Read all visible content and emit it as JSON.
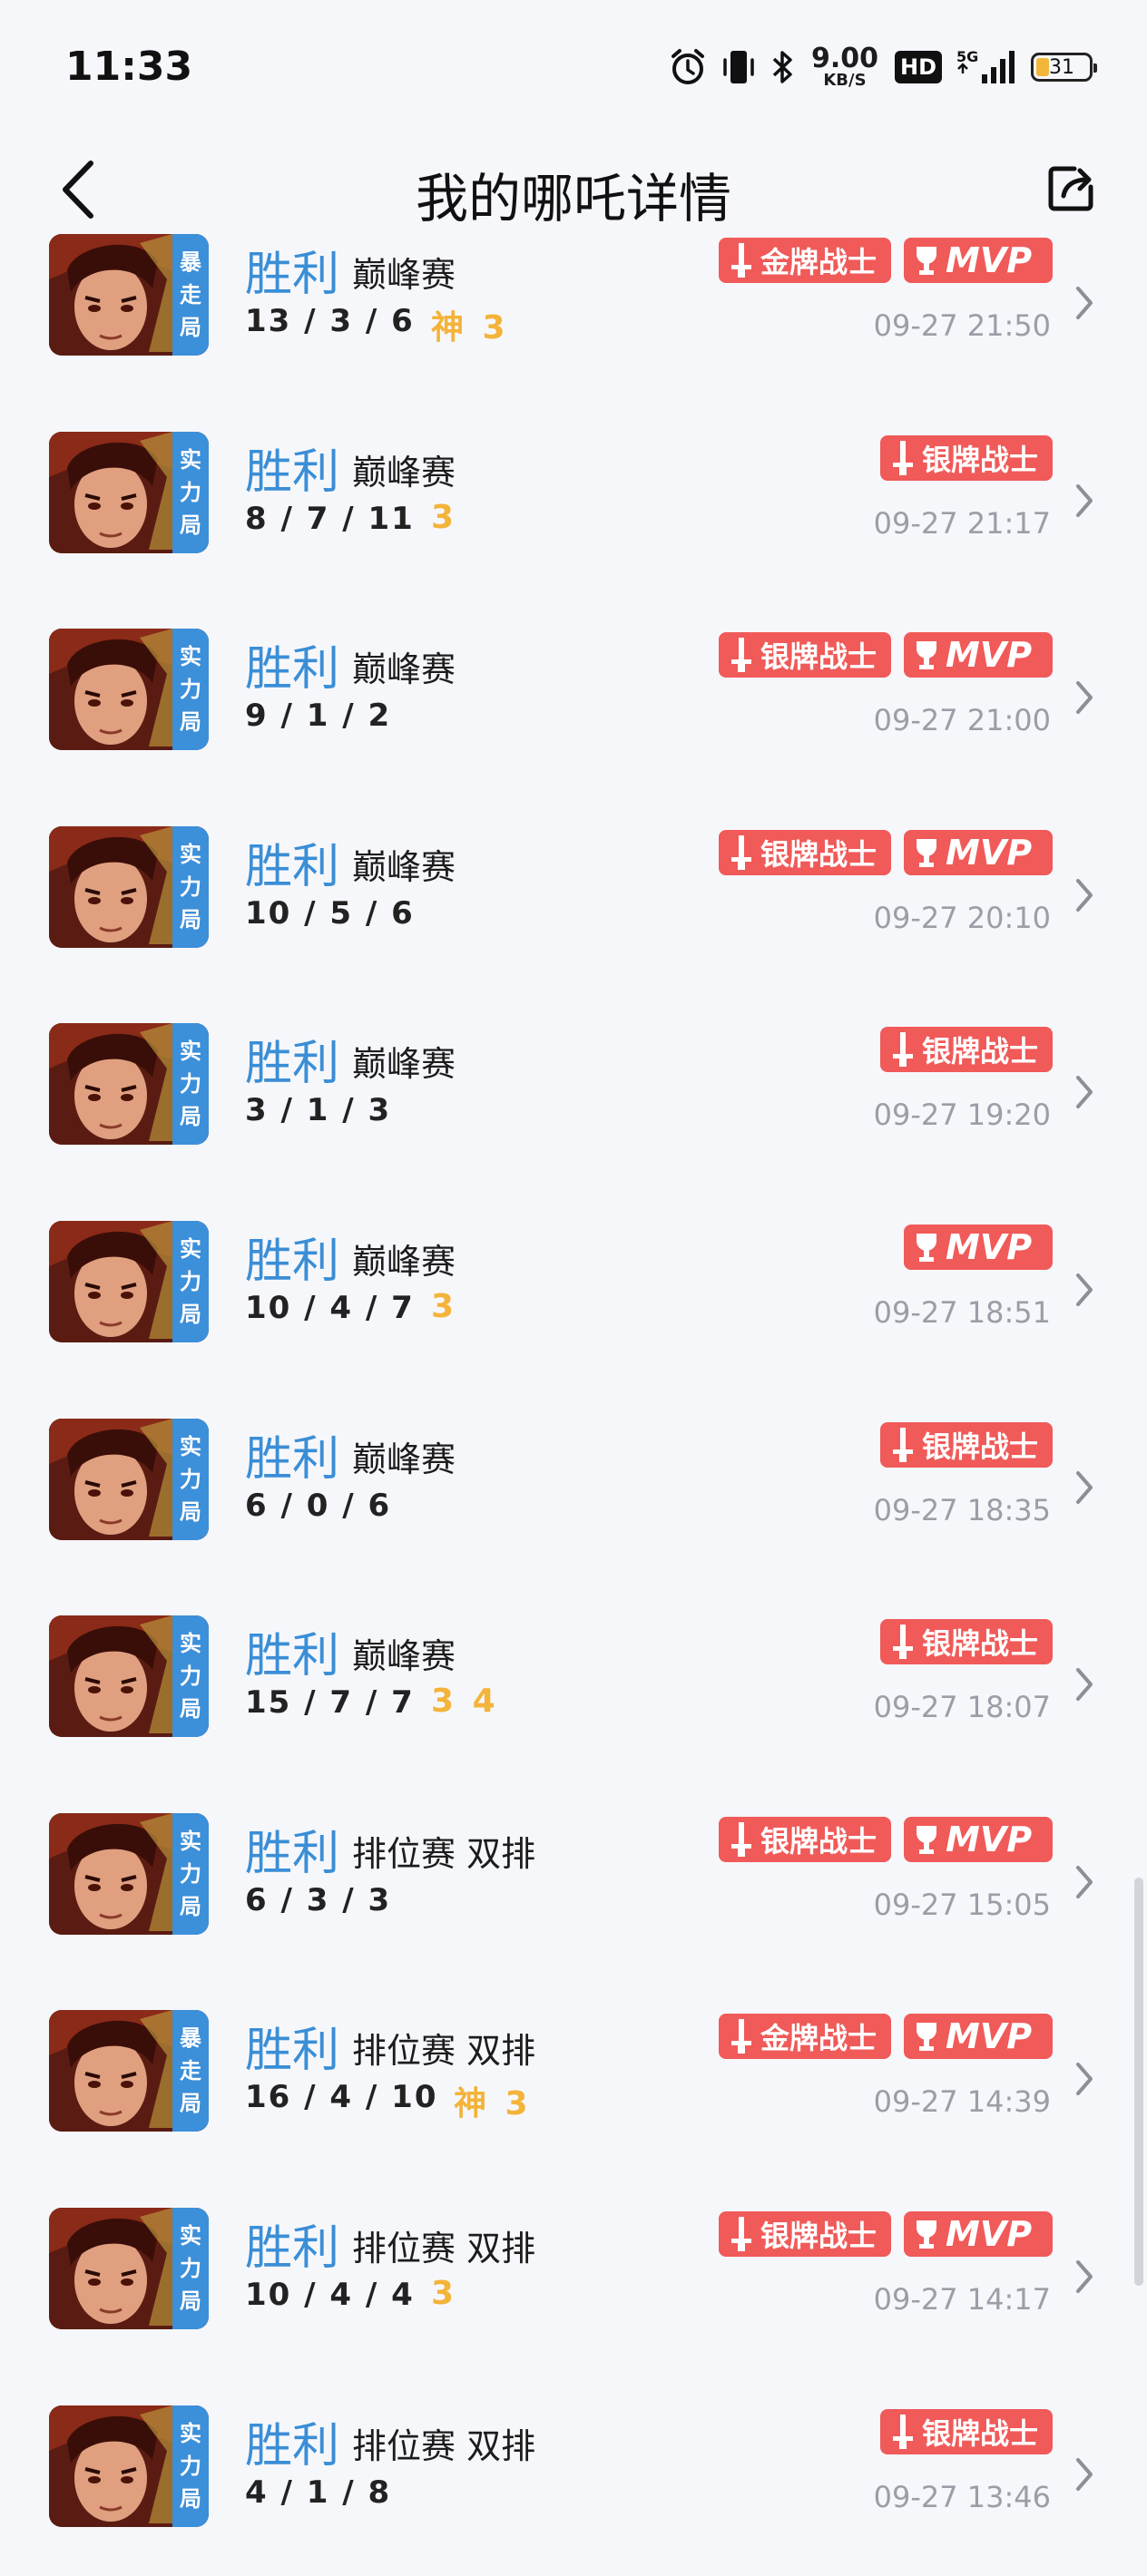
{
  "status_bar": {
    "time": "11:33",
    "speed_value": "9.00",
    "speed_unit": "KB/S",
    "hd": "HD",
    "network": "5G",
    "battery": "31"
  },
  "header": {
    "title": "我的哪吒详情"
  },
  "colors": {
    "win": "#3a8ed6",
    "badge_red": "#f05a59",
    "mode_tag_blue": "#3c8fd9",
    "accent_gold": "#f4b339"
  },
  "matches": [
    {
      "tag": [
        "暴",
        "走",
        "局"
      ],
      "result": "胜利",
      "mode": "巅峰赛",
      "kda": "13 / 3 / 6",
      "extra": "神 3",
      "badges": [
        {
          "type": "warrior",
          "label": "金牌战士"
        },
        {
          "type": "mvp",
          "label": "MVP"
        }
      ],
      "time": "09-27 21:50"
    },
    {
      "tag": [
        "实",
        "力",
        "局"
      ],
      "result": "胜利",
      "mode": "巅峰赛",
      "kda": "8 / 7 / 11",
      "extra": "3",
      "badges": [
        {
          "type": "warrior",
          "label": "银牌战士"
        }
      ],
      "time": "09-27 21:17"
    },
    {
      "tag": [
        "实",
        "力",
        "局"
      ],
      "result": "胜利",
      "mode": "巅峰赛",
      "kda": "9 / 1 / 2",
      "extra": "",
      "badges": [
        {
          "type": "warrior",
          "label": "银牌战士"
        },
        {
          "type": "mvp",
          "label": "MVP"
        }
      ],
      "time": "09-27 21:00"
    },
    {
      "tag": [
        "实",
        "力",
        "局"
      ],
      "result": "胜利",
      "mode": "巅峰赛",
      "kda": "10 / 5 / 6",
      "extra": "",
      "badges": [
        {
          "type": "warrior",
          "label": "银牌战士"
        },
        {
          "type": "mvp",
          "label": "MVP"
        }
      ],
      "time": "09-27 20:10"
    },
    {
      "tag": [
        "实",
        "力",
        "局"
      ],
      "result": "胜利",
      "mode": "巅峰赛",
      "kda": "3 / 1 / 3",
      "extra": "",
      "badges": [
        {
          "type": "warrior",
          "label": "银牌战士"
        }
      ],
      "time": "09-27 19:20"
    },
    {
      "tag": [
        "实",
        "力",
        "局"
      ],
      "result": "胜利",
      "mode": "巅峰赛",
      "kda": "10 / 4 / 7",
      "extra": "3",
      "badges": [
        {
          "type": "mvp",
          "label": "MVP"
        }
      ],
      "time": "09-27 18:51"
    },
    {
      "tag": [
        "实",
        "力",
        "局"
      ],
      "result": "胜利",
      "mode": "巅峰赛",
      "kda": "6 / 0 / 6",
      "extra": "",
      "badges": [
        {
          "type": "warrior",
          "label": "银牌战士"
        }
      ],
      "time": "09-27 18:35"
    },
    {
      "tag": [
        "实",
        "力",
        "局"
      ],
      "result": "胜利",
      "mode": "巅峰赛",
      "kda": "15 / 7 / 7",
      "extra": "3 4",
      "badges": [
        {
          "type": "warrior",
          "label": "银牌战士"
        }
      ],
      "time": "09-27 18:07"
    },
    {
      "tag": [
        "实",
        "力",
        "局"
      ],
      "result": "胜利",
      "mode": "排位赛 双排",
      "kda": "6 / 3 / 3",
      "extra": "",
      "badges": [
        {
          "type": "warrior",
          "label": "银牌战士"
        },
        {
          "type": "mvp",
          "label": "MVP"
        }
      ],
      "time": "09-27 15:05"
    },
    {
      "tag": [
        "暴",
        "走",
        "局"
      ],
      "result": "胜利",
      "mode": "排位赛 双排",
      "kda": "16 / 4 / 10",
      "extra": "神 3",
      "badges": [
        {
          "type": "warrior",
          "label": "金牌战士"
        },
        {
          "type": "mvp",
          "label": "MVP"
        }
      ],
      "time": "09-27 14:39"
    },
    {
      "tag": [
        "实",
        "力",
        "局"
      ],
      "result": "胜利",
      "mode": "排位赛 双排",
      "kda": "10 / 4 / 4",
      "extra": "3",
      "badges": [
        {
          "type": "warrior",
          "label": "银牌战士"
        },
        {
          "type": "mvp",
          "label": "MVP"
        }
      ],
      "time": "09-27 14:17"
    },
    {
      "tag": [
        "实",
        "力",
        "局"
      ],
      "result": "胜利",
      "mode": "排位赛 双排",
      "kda": "4 / 1 / 8",
      "extra": "",
      "badges": [
        {
          "type": "warrior",
          "label": "银牌战士"
        }
      ],
      "time": "09-27 13:46"
    }
  ]
}
